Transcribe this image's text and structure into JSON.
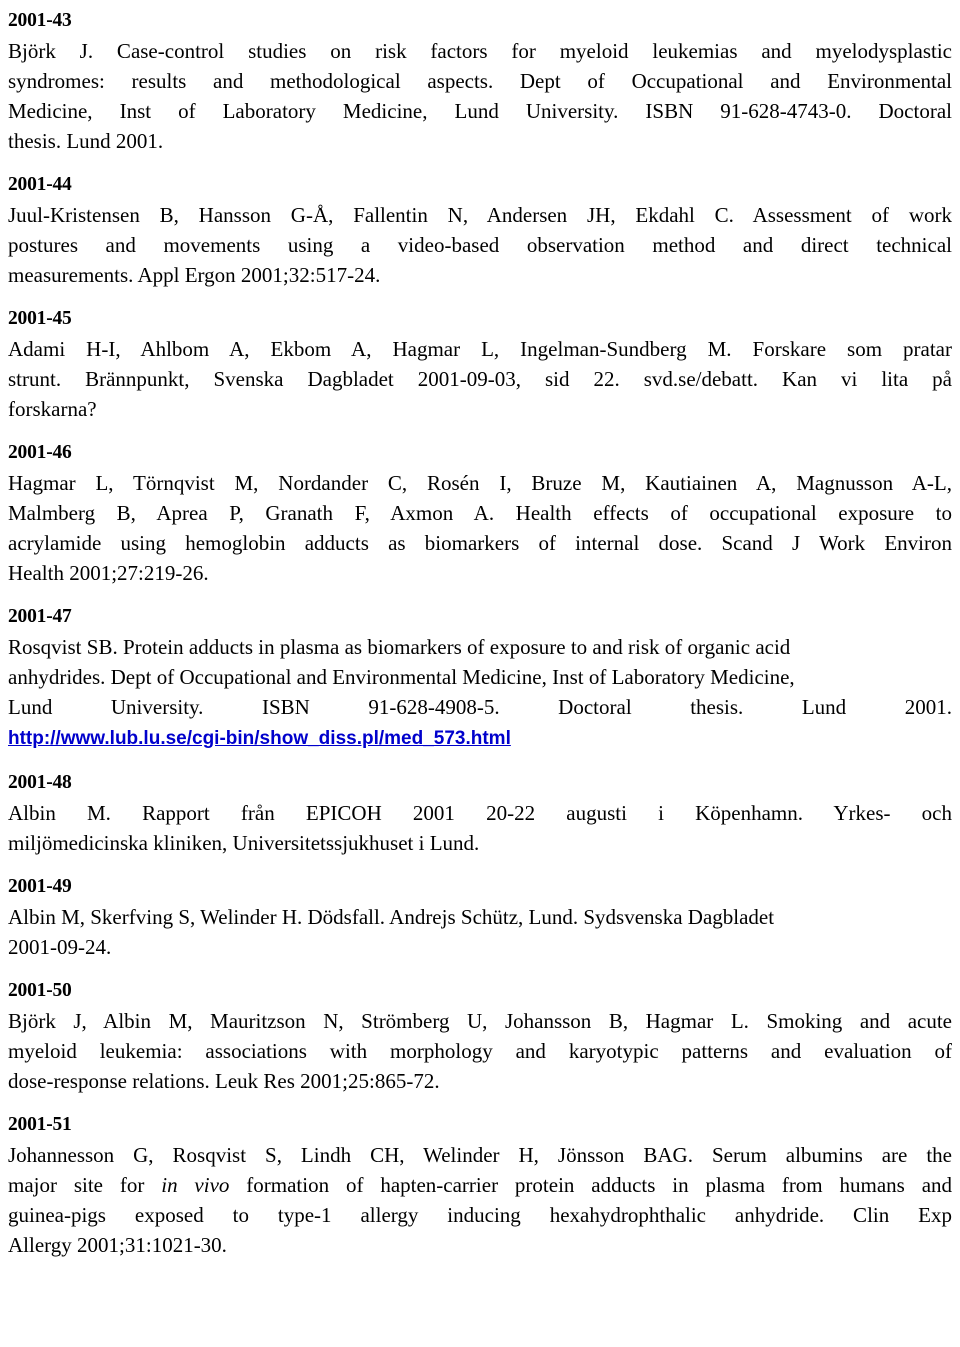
{
  "document": {
    "type": "publication-reference-list",
    "year_prefix": "2001",
    "link_color": "#0000cc",
    "text_color": "#000000",
    "background_color": "#ffffff"
  },
  "entries": [
    {
      "id": "2001-43",
      "lines": [
        "Björk J. Case-control studies on risk factors for myeloid leukemias and myelodysplastic",
        "syndromes: results and methodological aspects. Dept of Occupational and Environmental",
        "Medicine, Inst of Laboratory Medicine, Lund University. ISBN 91-628-4743-0. Doctoral",
        "thesis. Lund 2001."
      ],
      "text": "Björk J. Case-control studies on risk factors for myeloid leukemias and myelodysplastic syndromes: results and methodological aspects. Dept of Occupational and Environmental Medicine, Inst of Laboratory Medicine, Lund University. ISBN 91-628-4743-0. Doctoral thesis. Lund 2001."
    },
    {
      "id": "2001-44",
      "lines": [
        "Juul-Kristensen B, Hansson G-Å, Fallentin N, Andersen JH, Ekdahl C. Assessment of work",
        "postures and movements using a video-based observation method and direct technical",
        "measurements. Appl Ergon  2001;32:517-24."
      ],
      "text": "Juul-Kristensen B, Hansson G-Å, Fallentin N, Andersen JH, Ekdahl C. Assessment of work postures and movements using a video-based observation method and direct technical measurements. Appl Ergon  2001;32:517-24."
    },
    {
      "id": "2001-45",
      "lines": [
        "Adami H-I, Ahlbom A, Ekbom A, Hagmar L, Ingelman-Sundberg M. Forskare som pratar",
        "strunt. Brännpunkt, Svenska Dagbladet 2001-09-03, sid 22. svd.se/debatt. Kan vi lita på",
        "forskarna?"
      ],
      "text": "Adami H-I, Ahlbom A, Ekbom A, Hagmar L, Ingelman-Sundberg M. Forskare som pratar strunt. Brännpunkt, Svenska Dagbladet 2001-09-03, sid 22. svd.se/debatt. Kan vi lita på forskarna?"
    },
    {
      "id": "2001-46",
      "lines": [
        "Hagmar L, Törnqvist M, Nordander C, Rosén I, Bruze M, Kautiainen A, Magnusson A-L,",
        "Malmberg B, Aprea P, Granath F, Axmon A. Health effects of occupational exposure to",
        "acrylamide using hemoglobin adducts as biomarkers of internal dose. Scand J Work Environ",
        "Health 2001;27:219-26."
      ],
      "text": "Hagmar L, Törnqvist M, Nordander C, Rosén I, Bruze M, Kautiainen A, Magnusson A-L, Malmberg B, Aprea P, Granath F, Axmon A. Health effects of occupational exposure to acrylamide using hemoglobin adducts as biomarkers of internal dose. Scand J Work Environ Health 2001;27:219-26."
    },
    {
      "id": "2001-47",
      "lines": [
        "Rosqvist SB. Protein adducts in plasma as biomarkers of exposure to and risk of organic acid",
        "anhydrides. Dept of Occupational and Environmental Medicine, Inst of Laboratory Medicine,",
        "Lund University. ISBN 91-628-4908-5. Doctoral thesis. Lund 2001."
      ],
      "text": "Rosqvist SB. Protein adducts in plasma as biomarkers of exposure to and risk of organic acid anhydrides. Dept of Occupational and Environmental Medicine, Inst of Laboratory Medicine, Lund University. ISBN 91-628-4908-5. Doctoral thesis. Lund 2001.",
      "link": "http://www.lub.lu.se/cgi-bin/show_diss.pl/med_573.html"
    },
    {
      "id": "2001-48",
      "lines": [
        "Albin M. Rapport från EPICOH 2001 20-22 augusti i Köpenhamn. Yrkes- och",
        "miljömedicinska kliniken, Universitetssjukhuset i Lund."
      ],
      "text": "Albin M. Rapport från EPICOH 2001 20-22 augusti i Köpenhamn. Yrkes- och miljömedicinska kliniken, Universitetssjukhuset i Lund."
    },
    {
      "id": "2001-49",
      "lines": [
        "Albin M, Skerfving S, Welinder H. Dödsfall. Andrejs Schütz, Lund. Sydsvenska Dagbladet",
        "2001-09-24."
      ],
      "text": "Albin M, Skerfving S, Welinder H. Dödsfall. Andrejs Schütz, Lund. Sydsvenska Dagbladet 2001-09-24."
    },
    {
      "id": "2001-50",
      "lines": [
        "Björk J, Albin M, Mauritzson N, Strömberg U, Johansson B, Hagmar L. Smoking and acute",
        "myeloid leukemia: associations with morphology and karyotypic patterns and evaluation of",
        "dose-response relations. Leuk Res 2001;25:865-72."
      ],
      "text": "Björk J, Albin M, Mauritzson N, Strömberg U, Johansson B, Hagmar L. Smoking and acute myeloid leukemia: associations with morphology and karyotypic patterns and evaluation of dose-response relations. Leuk Res 2001;25:865-72."
    },
    {
      "id": "2001-51",
      "lines": [
        "Johannesson G, Rosqvist S, Lindh CH, Welinder H, Jönsson BAG. Serum albumins are the",
        "major site for ",
        "in vivo",
        " formation of hapten-carrier protein adducts in plasma from humans and",
        "guinea-pigs exposed to type-1 allergy inducing hexahydrophthalic anhydride. Clin Exp",
        "Allergy 2001;31:1021-30."
      ],
      "segments": {
        "line1": "Johannesson G, Rosqvist S, Lindh CH, Welinder H, Jönsson BAG. Serum albumins are the",
        "line2_pre": "major site for ",
        "line2_italic": "in vivo",
        "line2_post": " formation of hapten-carrier protein adducts in plasma from humans and",
        "line3": "guinea-pigs exposed to type-1 allergy inducing hexahydrophthalic anhydride. Clin Exp",
        "line4": "Allergy 2001;31:1021-30."
      },
      "text": "Johannesson G, Rosqvist S, Lindh CH, Welinder H, Jönsson BAG. Serum albumins are the major site for in vivo formation of hapten-carrier protein adducts in plasma from humans and guinea-pigs exposed to type-1 allergy inducing hexahydrophthalic anhydride. Clin Exp Allergy 2001;31:1021-30."
    }
  ]
}
